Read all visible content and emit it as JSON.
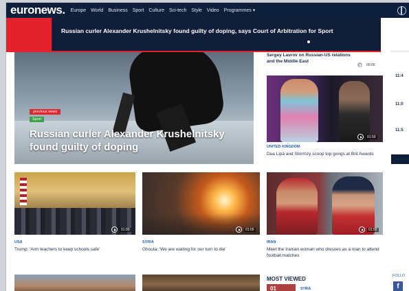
{
  "header": {
    "logo": "euronews.",
    "nav": [
      "Europe",
      "World",
      "Business",
      "Sport",
      "Culture",
      "Sci-tech",
      "Style",
      "Video",
      "Programmes ▾"
    ]
  },
  "banner": {
    "text": "Russian curler Alexander Krushelnitsky found guilty of doping, says Court of Arbitration for Sport"
  },
  "hero": {
    "tag": "previous news",
    "category": "Sport",
    "title": "Russian curler Alexander Krushelnitsky found guilty of doping"
  },
  "right_column": {
    "top_title": "Sergey Lavrov on Russian-US relations and the Middle East",
    "top_duration": "00:00",
    "card": {
      "duration": "01:50",
      "category": "United Kingdom",
      "title": "Dua Lipa and Stormzy scoop top gongs at Brit Awards"
    }
  },
  "times": [
    "11:4",
    "11:0",
    "11:5"
  ],
  "cards": [
    {
      "category": "USA",
      "title": "Trump: 'Arm teachers to keep schools safe'",
      "duration": "01:00"
    },
    {
      "category": "SYRIA",
      "title": "Ghouta: 'We are waiting for our turn to die'",
      "duration": "01:05"
    },
    {
      "category": "IRAN",
      "title": "Meet the Iranian woman who dresses as a man to attend football matches",
      "duration": "01:50"
    }
  ],
  "most_viewed": {
    "heading": "MOST VIEWED",
    "rank": "01",
    "category": "SYRIA"
  },
  "follow": {
    "label": "FOLLO",
    "fb": "f"
  }
}
